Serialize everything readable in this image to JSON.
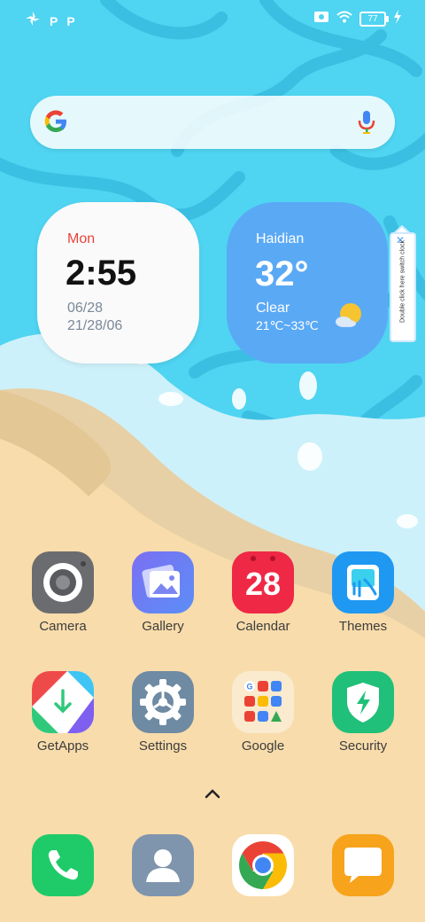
{
  "status_bar": {
    "notif_icons": [
      "fan-icon",
      "p-icon",
      "p-icon"
    ],
    "p_label": "P",
    "battery": "77",
    "icons": [
      "screen-record-icon",
      "wifi-icon",
      "battery-icon",
      "charging-icon"
    ]
  },
  "search": {
    "placeholder": "",
    "icons": [
      "google-logo-icon",
      "mic-icon"
    ]
  },
  "clock_widget": {
    "day": "Mon",
    "time": "2:55",
    "date": "06/28",
    "alt_date": "21/28/06"
  },
  "weather_widget": {
    "city": "Haidian",
    "temperature": "32°",
    "condition": "Clear",
    "range": "21℃~33℃",
    "icon": "sun-cloud-icon"
  },
  "switch_tab": {
    "text": "Double click here switch clock",
    "close_label": "✕"
  },
  "apps_row1": [
    {
      "label": "Camera",
      "icon": "camera-icon"
    },
    {
      "label": "Gallery",
      "icon": "gallery-icon"
    },
    {
      "label": "Calendar",
      "icon": "calendar-icon",
      "badge": "28"
    },
    {
      "label": "Themes",
      "icon": "themes-icon"
    }
  ],
  "apps_row2": [
    {
      "label": "GetApps",
      "icon": "getapps-icon"
    },
    {
      "label": "Settings",
      "icon": "settings-icon"
    },
    {
      "label": "Google",
      "icon": "google-folder-icon"
    },
    {
      "label": "Security",
      "icon": "security-icon"
    }
  ],
  "dock": [
    {
      "icon": "phone-icon"
    },
    {
      "icon": "contacts-icon"
    },
    {
      "icon": "chrome-icon"
    },
    {
      "icon": "messages-icon"
    }
  ],
  "colors": {
    "sea": "#4dd3f0",
    "sand": "#f7dbaa",
    "weather": "#5aa9f5",
    "calendar": "#ef2845",
    "security": "#20c07a"
  }
}
